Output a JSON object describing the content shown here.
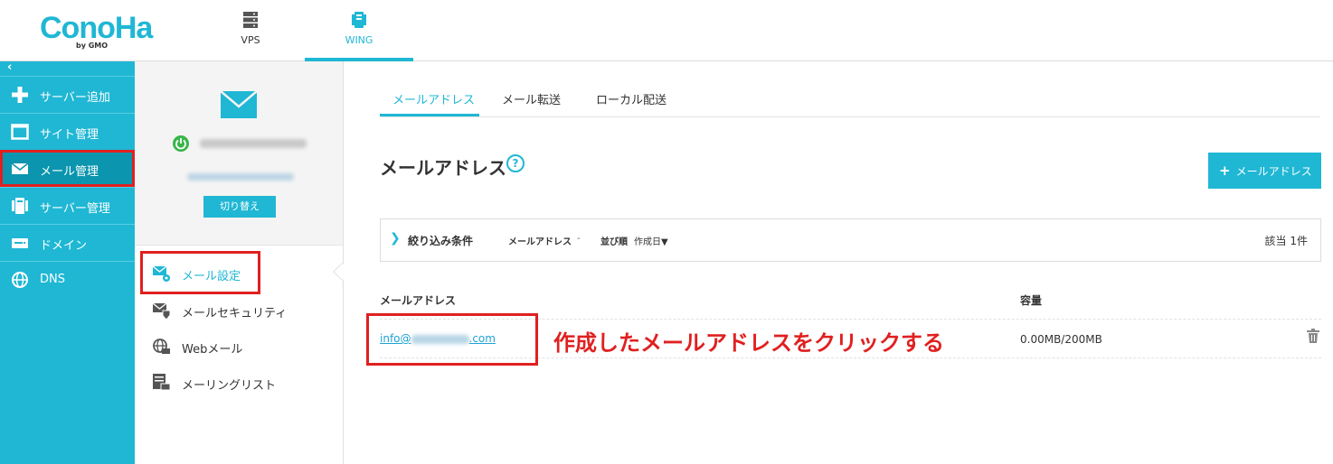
{
  "header": {
    "logo_text": "ConoHa",
    "logo_by": "by GMO",
    "nav": [
      {
        "label": "VPS",
        "icon": "server-icon"
      },
      {
        "label": "WING",
        "icon": "wing-icon"
      }
    ]
  },
  "sidebar": {
    "collapse_label": "‹",
    "items": [
      {
        "label": "サーバー追加",
        "icon": "plus-icon"
      },
      {
        "label": "サイト管理",
        "icon": "window-icon"
      },
      {
        "label": "メール管理",
        "icon": "mail-icon"
      },
      {
        "label": "サーバー管理",
        "icon": "server-manage-icon"
      },
      {
        "label": "ドメイン",
        "icon": "domain-icon"
      },
      {
        "label": "DNS",
        "icon": "globe-icon"
      }
    ]
  },
  "subpanel": {
    "switch_label": "切り替え",
    "items": [
      {
        "label": "メール設定",
        "icon": "mail-settings-icon"
      },
      {
        "label": "メールセキュリティ",
        "icon": "mail-security-icon"
      },
      {
        "label": "Webメール",
        "icon": "webmail-icon"
      },
      {
        "label": "メーリングリスト",
        "icon": "mailing-list-icon"
      }
    ]
  },
  "main": {
    "tabs": [
      {
        "label": "メールアドレス"
      },
      {
        "label": "メール転送"
      },
      {
        "label": "ローカル配送"
      }
    ],
    "title": "メールアドレス",
    "help": "?",
    "add_button": "メールアドレス",
    "filter": {
      "toggle_label": "絞り込み条件",
      "mail_label": "メールアドレス",
      "mail_value": "-",
      "sort_label": "並び順",
      "sort_value": "作成日▼",
      "count": "該当 1件"
    },
    "columns": {
      "address": "メールアドレス",
      "capacity": "容量"
    },
    "rows": [
      {
        "email_prefix": "info@",
        "email_suffix": ".com",
        "capacity": "0.00MB/200MB"
      }
    ],
    "annotation": "作成したメールアドレスをクリックする"
  },
  "colors": {
    "brand": "#1fb7d4",
    "sidebar_active": "#0b95ae",
    "highlight": "#e02020"
  }
}
